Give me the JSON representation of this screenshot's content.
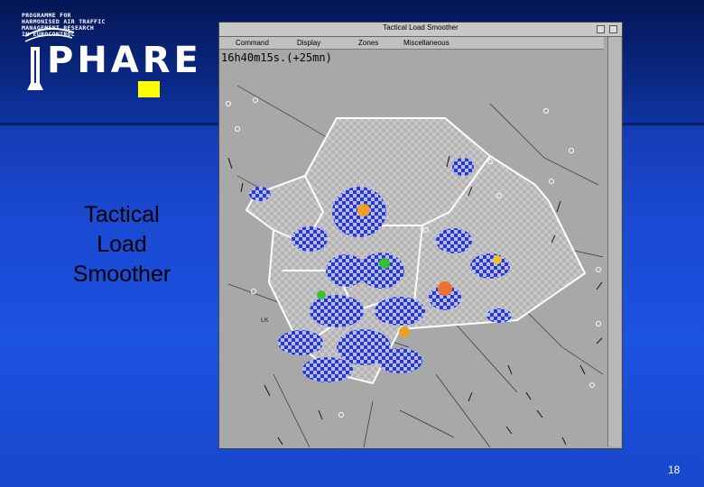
{
  "logo": {
    "text_lines": [
      "PROGRAMME  FOR",
      "HARMONISED  AIR  TRAFFIC",
      "MANAGEMENT  RESEARCH",
      "IN  EUROCONTROL"
    ],
    "name": "PHARE"
  },
  "slide": {
    "title_lines": [
      "Tactical",
      "Load",
      "Smoother"
    ],
    "page_number": "18"
  },
  "window": {
    "title": "Tactical Load Smoother",
    "menu": [
      "Command",
      "Display",
      "Zones",
      "Miscellaneous"
    ],
    "time_readout": "16h40m15s.(+25mn)"
  },
  "map": {
    "sector_label": "LK",
    "colors": {
      "hotspot_blue": "#1f35ff",
      "sector_fill": "#bdbdbd",
      "background": "#a8a8a8"
    }
  }
}
